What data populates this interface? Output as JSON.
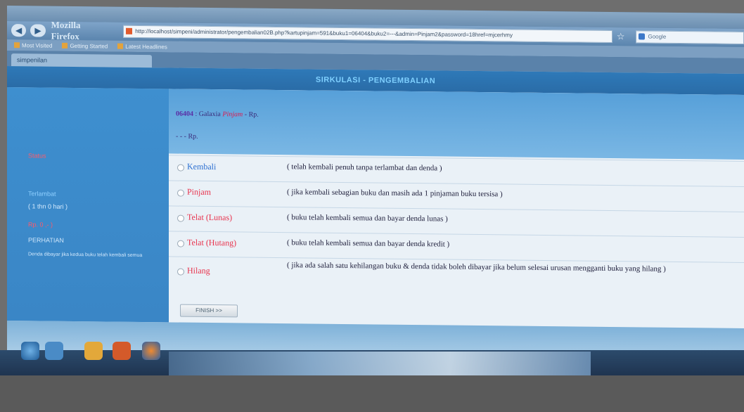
{
  "browser": {
    "brand": "Mozilla Firefox",
    "url": "http://localhost/simpeni/administrator/pengembalian02B.php?kartupinjam=591&buku1=06404&buku2=---&admin=Pinjam2&password=18href=mjcerhmy",
    "search_placeholder": "Google",
    "bookmarks": [
      "Most Visited",
      "Getting Started",
      "Latest Headlines"
    ],
    "tab_title": "simpenilan"
  },
  "page": {
    "header_title": "SIRKULASI - PENGEMBALIAN",
    "book_code": "06404",
    "book_title": "Galaxia",
    "status_word": "Pinjam",
    "rp_suffix": "- Rp.",
    "line2": "- - - Rp.",
    "left_labels": {
      "status": "Status",
      "terlambat": "Terlambat",
      "duration": "( 1 thn 0 hari )",
      "denda": "Rp. 0 ,- )",
      "perhatian": "PERHATIAN",
      "note": "Denda dibayar jika kedua buku telah kembali semua"
    },
    "options": [
      {
        "label": "Kembali",
        "desc": "( telah kembali penuh tanpa terlambat dan denda )"
      },
      {
        "label": "Pinjam",
        "desc": "( jika kembali sebagian buku dan masih ada 1 pinjaman buku tersisa )"
      },
      {
        "label": "Telat (Lunas)",
        "desc": "( buku telah kembali semua dan bayar denda lunas )"
      },
      {
        "label": "Telat (Hutang)",
        "desc": "( buku telah kembali semua dan bayar denda kredit )"
      },
      {
        "label": "Hilang",
        "desc": "( jika ada salah satu kehilangan buku & denda tidak boleh dibayar jika belum selesai urusan mengganti buku yang hilang )"
      }
    ],
    "finish_label": "FINISH >>"
  },
  "colors": {
    "header_bg": "#2e79b8",
    "option_label": "#e8334d",
    "kembali_label": "#2c6fd1"
  }
}
